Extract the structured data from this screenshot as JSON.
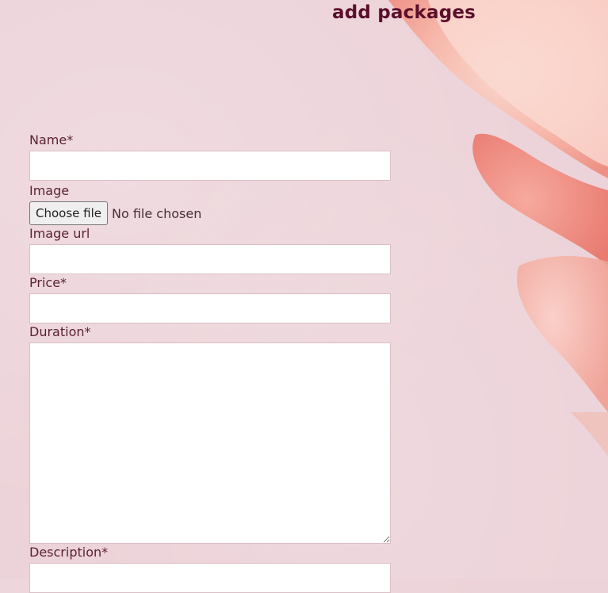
{
  "page": {
    "title": "add packages"
  },
  "form": {
    "name_label": "Name*",
    "image_label": "Image",
    "choose_file_label": "Choose file",
    "file_status": "No file chosen",
    "image_url_label": "Image url",
    "price_label": "Price*",
    "duration_label": "Duration*",
    "description_label": "Description*"
  },
  "colors": {
    "background": "#ecd3d9",
    "title": "#5b0f2b",
    "label": "#5a2233",
    "petal": "#f3a79c"
  }
}
